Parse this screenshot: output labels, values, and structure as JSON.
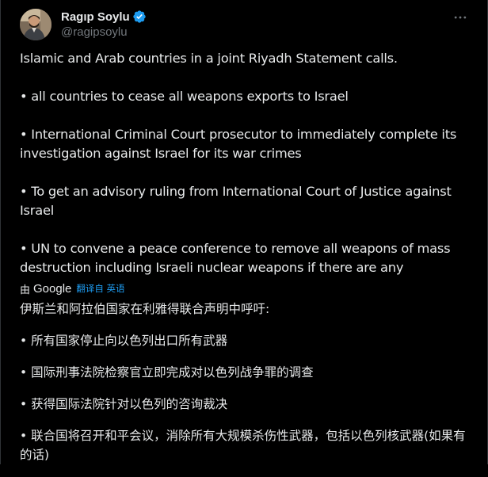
{
  "author": {
    "display_name": "Ragıp Soylu",
    "handle": "@ragipsoylu",
    "avatar_icon": "avatar-image",
    "verified_icon": "verified-badge-icon",
    "verified_color": "#1d9bf0"
  },
  "menu": {
    "more_icon": "more-horizontal-icon"
  },
  "tweet": {
    "paragraphs": [
      "Islamic and Arab countries in a joint Riyadh Statement calls.",
      "• all countries to cease all weapons exports to Israel",
      "• International Criminal Court prosecutor to immediately complete its investigation against Israel for its war crimes",
      "• To get an advisory ruling from International Court of Justice against Israel",
      "• UN to convene a peace conference to remove all weapons of mass destruction including Israeli nuclear weapons if there are any"
    ]
  },
  "translation": {
    "by_label": "由",
    "provider": "Google",
    "link_label": "翻译自 英语",
    "paragraphs": [
      "伊斯兰和阿拉伯国家在利雅得联合声明中呼吁:",
      "• 所有国家停止向以色列出口所有武器",
      "• 国际刑事法院检察官立即完成对以色列战争罪的调查",
      "• 获得国际法院针对以色列的咨询裁决",
      "• 联合国将召开和平会议，消除所有大规模杀伤性武器，包括以色列核武器(如果有的话)"
    ]
  },
  "colors": {
    "background": "#000000",
    "text": "#e7e9ea",
    "secondary_text": "#71767b",
    "link": "#1d9bf0"
  }
}
